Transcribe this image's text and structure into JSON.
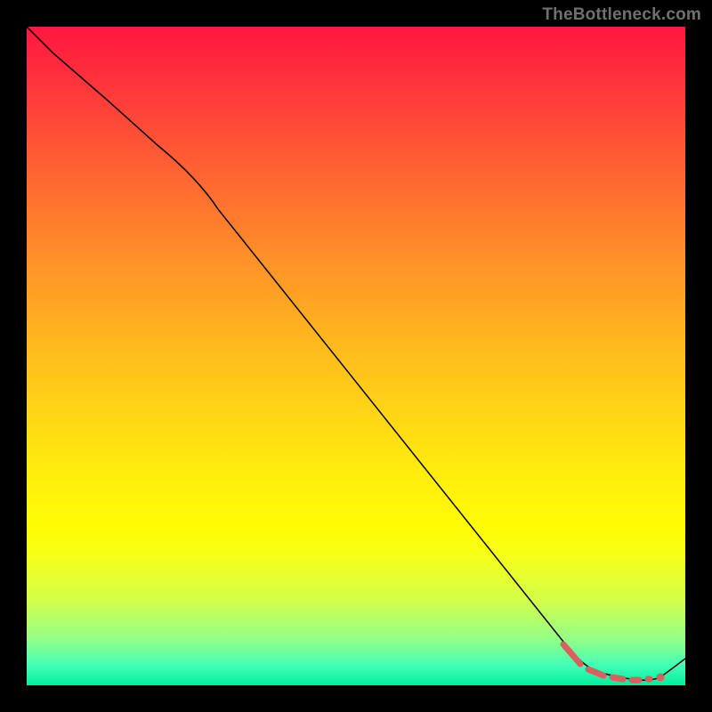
{
  "attribution": "TheBottleneck.com",
  "colors": {
    "page_bg": "#000000",
    "gradient_top": "#ff163f",
    "gradient_bottom": "#00ef9b",
    "curve": "#000000",
    "marker": "#d8605e"
  },
  "chart_data": {
    "type": "line",
    "title": "",
    "xlabel": "",
    "ylabel": "",
    "xlim": [
      0,
      100
    ],
    "ylim": [
      0,
      100
    ],
    "series": [
      {
        "name": "bottleneck-curve",
        "x": [
          0,
          4,
          12,
          20,
          26,
          82,
          85,
          90,
          93,
          96,
          100
        ],
        "y": [
          100,
          96,
          89,
          82,
          77,
          6,
          3,
          1,
          0.5,
          1,
          4
        ]
      }
    ],
    "markers": [
      {
        "name": "current-position-dot",
        "x": 95.3,
        "y": 1
      }
    ],
    "highlight_segment": {
      "name": "optimal-range",
      "x_start": 82,
      "x_end": 94,
      "style": "dashed"
    }
  }
}
